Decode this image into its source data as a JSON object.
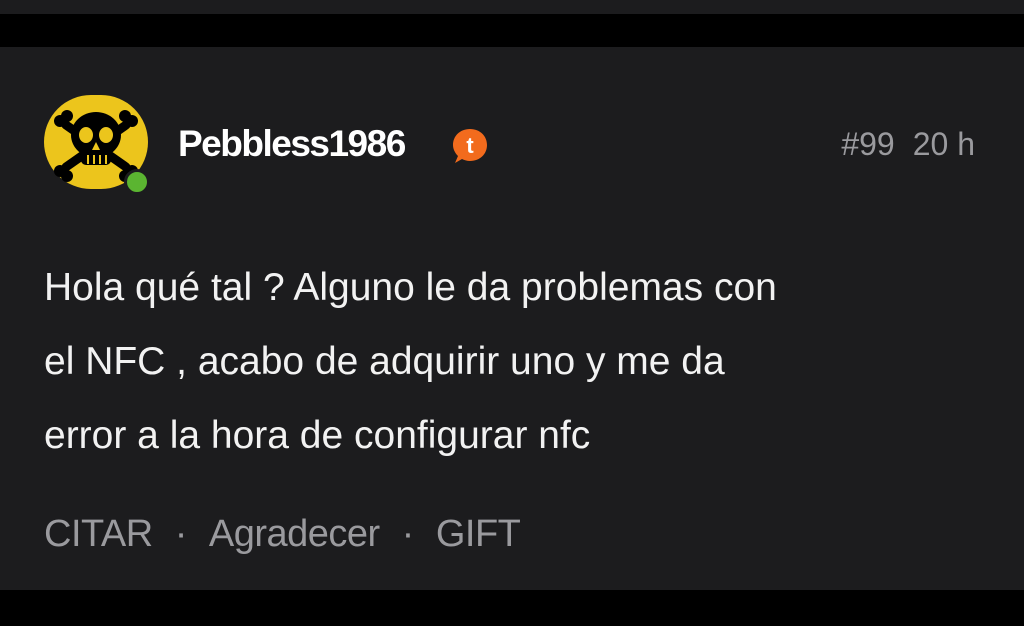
{
  "post": {
    "author": {
      "username": "Pebbless1986",
      "avatar_icon": "skull-crossbones-icon",
      "avatar_bg": "#ecc51c",
      "online": true,
      "online_color": "#5bb531",
      "badge_icon": "chat-bubble-t-icon",
      "badge_letter": "t",
      "badge_color": "#f26b1d"
    },
    "number": "#99",
    "time": "20 h",
    "body_lines": [
      "Hola qué tal ? Alguno le da problemas con",
      "el NFC , acabo de adquirir uno y me da",
      "error a la hora de configurar nfc"
    ],
    "actions": {
      "quote": "CITAR",
      "thank": "Agradecer",
      "gift": "GIFT",
      "separator": "·"
    }
  },
  "colors": {
    "background": "#1c1c1e",
    "text": "#f2f2f2",
    "muted": "#9a9a9e"
  }
}
